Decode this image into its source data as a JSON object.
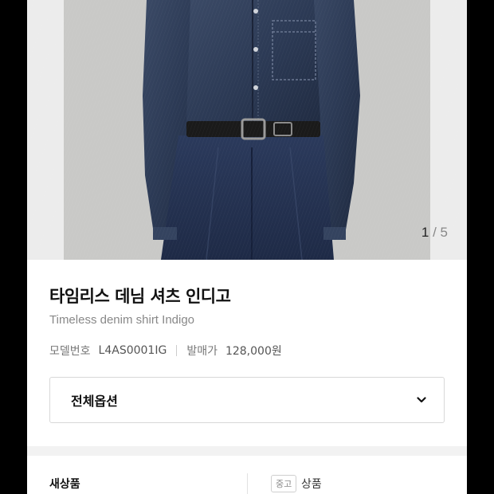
{
  "gallery": {
    "current": "1",
    "separator": "/",
    "total": "5"
  },
  "product": {
    "title_ko": "타임리스 데님 셔츠 인디고",
    "title_en": "Timeless denim shirt Indigo",
    "model_label": "모델번호",
    "model_value": "L4AS0001IG",
    "price_label": "발매가",
    "price_value": "128,000원"
  },
  "options": {
    "label": "전체옵션",
    "icon": "chevron-down-icon"
  },
  "condition": {
    "new_label": "새상품",
    "used_badge": "중고",
    "used_label": "상품"
  },
  "colors": {
    "denim": "#2d3a52",
    "background": "#ffffff",
    "frame": "#000000"
  }
}
